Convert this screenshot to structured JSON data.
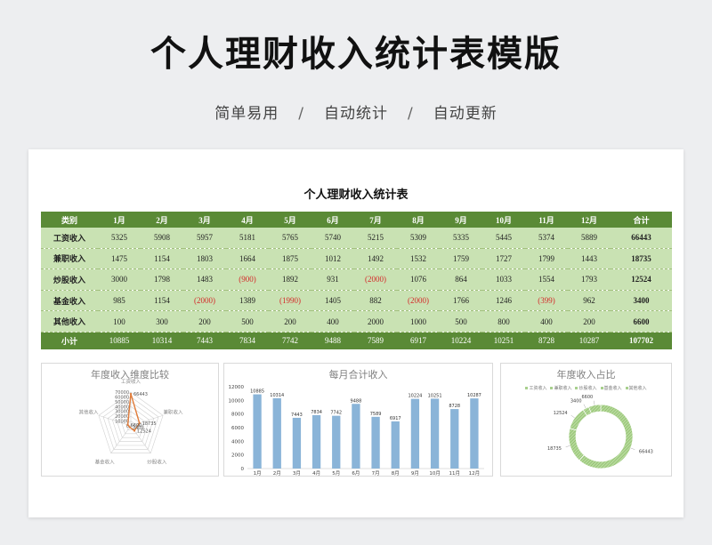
{
  "header": {
    "title": "个人理财收入统计表模版",
    "features": [
      "简单易用",
      "自动统计",
      "自动更新"
    ],
    "separator": "/"
  },
  "sheet": {
    "title": "个人理财收入统计表",
    "columns": [
      "类别",
      "1月",
      "2月",
      "3月",
      "4月",
      "5月",
      "6月",
      "7月",
      "8月",
      "9月",
      "10月",
      "11月",
      "12月",
      "合计"
    ],
    "rows": [
      {
        "label": "工资收入",
        "values": [
          "5325",
          "5908",
          "5957",
          "5181",
          "5765",
          "5740",
          "5215",
          "5309",
          "5335",
          "5445",
          "5374",
          "5889"
        ],
        "total": "66443"
      },
      {
        "label": "兼职收入",
        "values": [
          "1475",
          "1154",
          "1803",
          "1664",
          "1875",
          "1012",
          "1492",
          "1532",
          "1759",
          "1727",
          "1799",
          "1443"
        ],
        "total": "18735"
      },
      {
        "label": "炒股收入",
        "values": [
          "3000",
          "1798",
          "1483",
          "(900)",
          "1892",
          "931",
          "(2000)",
          "1076",
          "864",
          "1033",
          "1554",
          "1793"
        ],
        "total": "12524"
      },
      {
        "label": "基金收入",
        "values": [
          "985",
          "1154",
          "(2000)",
          "1389",
          "(1990)",
          "1405",
          "882",
          "(2000)",
          "1766",
          "1246",
          "(399)",
          "962"
        ],
        "total": "3400"
      },
      {
        "label": "其他收入",
        "values": [
          "100",
          "300",
          "200",
          "500",
          "200",
          "400",
          "2000",
          "1000",
          "500",
          "800",
          "400",
          "200"
        ],
        "total": "6600"
      }
    ],
    "subtotal": {
      "label": "小计",
      "values": [
        "10885",
        "10314",
        "7443",
        "7834",
        "7742",
        "9488",
        "7589",
        "6917",
        "10224",
        "10251",
        "8728",
        "10287"
      ],
      "total": "107702"
    }
  },
  "colors": {
    "header_green": "#5a8a36",
    "row_green": "#c9e2b3",
    "bar_blue": "#8ab4d8",
    "radar_orange": "#e07b39",
    "negative_red": "#d42a2a"
  },
  "chart_data": [
    {
      "type": "radar",
      "title": "年度收入维度比较",
      "axes": [
        "工资收入",
        "兼职收入",
        "炒股收入",
        "基金收入",
        "其他收入"
      ],
      "values": [
        66443,
        18735,
        12524,
        3400,
        6600
      ],
      "data_labels": [
        "66443",
        "18735",
        "12524",
        "3400",
        "6600"
      ],
      "tick_labels": [
        "70000",
        "60000",
        "50000",
        "40000",
        "30000",
        "20000",
        "10000",
        "0"
      ],
      "range": [
        0,
        70000
      ]
    },
    {
      "type": "bar",
      "title": "每月合计收入",
      "categories": [
        "1月",
        "2月",
        "3月",
        "4月",
        "5月",
        "6月",
        "7月",
        "8月",
        "9月",
        "10月",
        "11月",
        "12月"
      ],
      "values": [
        10885,
        10314,
        7443,
        7834,
        7742,
        9488,
        7589,
        6917,
        10224,
        10251,
        8728,
        10287
      ],
      "y_ticks": [
        "12000",
        "10000",
        "8000",
        "6000",
        "4000",
        "2000",
        "0"
      ],
      "ylim": [
        0,
        12000
      ]
    },
    {
      "type": "pie",
      "title": "年度收入占比",
      "categories": [
        "工资收入",
        "兼职收入",
        "炒股收入",
        "基金收入",
        "其他收入"
      ],
      "values": [
        66443,
        18735,
        12524,
        3400,
        6600
      ],
      "data_labels": [
        "66443",
        "18735",
        "12524",
        "3400",
        "6600"
      ],
      "legend_position": "top"
    }
  ]
}
